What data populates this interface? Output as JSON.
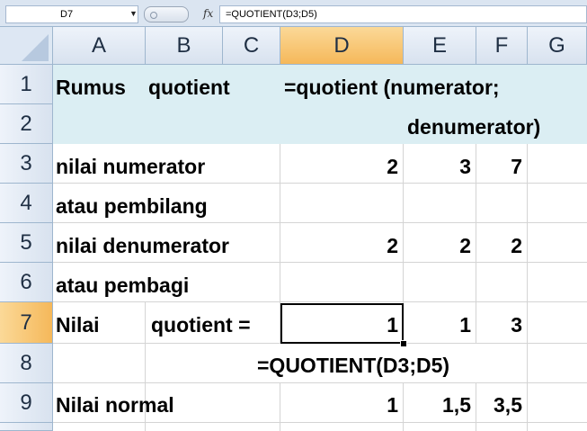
{
  "formula_bar": {
    "name_box": "D7",
    "fx_label": "fx",
    "formula": "=QUOTIENT(D3;D5)"
  },
  "columns": [
    "A",
    "B",
    "C",
    "D",
    "E",
    "F",
    "G"
  ],
  "rows": [
    "1",
    "2",
    "3",
    "4",
    "5",
    "6",
    "7",
    "8",
    "9"
  ],
  "cells": {
    "A1": "Rumus",
    "B1": "quotient",
    "D1": "=quotient (numerator;",
    "E2": "denumerator)",
    "A3": "nilai numerator",
    "D3": "2",
    "E3": "3",
    "F3": "7",
    "A4": "atau pembilang",
    "A5": "nilai denumerator",
    "D5": "2",
    "E5": "2",
    "F5": "2",
    "A6": "atau pembagi",
    "A7": "Nilai",
    "B7": "quotient =",
    "D7": "1",
    "E7": "1",
    "F7": "3",
    "C8": "=QUOTIENT(D3;D5)",
    "A9": "Nilai normal",
    "D9": "1",
    "E9": "1,5",
    "F9": "3,5"
  },
  "colors": {
    "header_band": "#dbeef3",
    "selected_header": "#f5b85a",
    "header_bg": "#dde7f3",
    "gridline": "#d4d4d4"
  },
  "selected_cell": "D7"
}
